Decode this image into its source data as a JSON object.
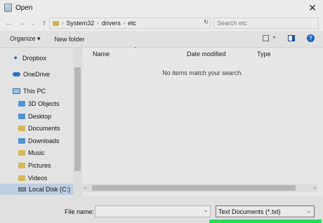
{
  "window": {
    "title": "Open",
    "close_glyph": "✕"
  },
  "nav": {
    "back": "←",
    "forward": "→",
    "recent": "⌄",
    "up": "↑",
    "breadcrumb": [
      "System32",
      "drivers",
      "etc"
    ],
    "breadcrumb_separator": "›",
    "refresh": "↻",
    "search_placeholder": "Search etc"
  },
  "toolbar": {
    "organize": "Organize ▾",
    "new_folder": "New folder",
    "help": "?"
  },
  "sidebar": {
    "items": [
      {
        "label": "Dropbox",
        "icon": "dropbox-icon"
      },
      {
        "label": "OneDrive",
        "icon": "onedrive-icon"
      },
      {
        "label": "This PC",
        "icon": "computer-icon"
      },
      {
        "label": "3D Objects",
        "icon": "folder-icon"
      },
      {
        "label": "Desktop",
        "icon": "folder-icon"
      },
      {
        "label": "Documents",
        "icon": "folder-icon"
      },
      {
        "label": "Downloads",
        "icon": "folder-icon"
      },
      {
        "label": "Music",
        "icon": "folder-icon"
      },
      {
        "label": "Pictures",
        "icon": "folder-icon"
      },
      {
        "label": "Videos",
        "icon": "folder-icon"
      },
      {
        "label": "Local Disk (C:)",
        "icon": "disk-icon"
      }
    ]
  },
  "content": {
    "columns": [
      "Name",
      "Date modified",
      "Type"
    ],
    "empty_message": "No items match your search."
  },
  "footer": {
    "file_name_label": "File name:",
    "file_name_value": "",
    "file_type": "Text Documents (*.txt)"
  },
  "colors": {
    "highlight": "#22dd5a",
    "accent": "#1a6fd1",
    "selected": "#cce0f5"
  }
}
